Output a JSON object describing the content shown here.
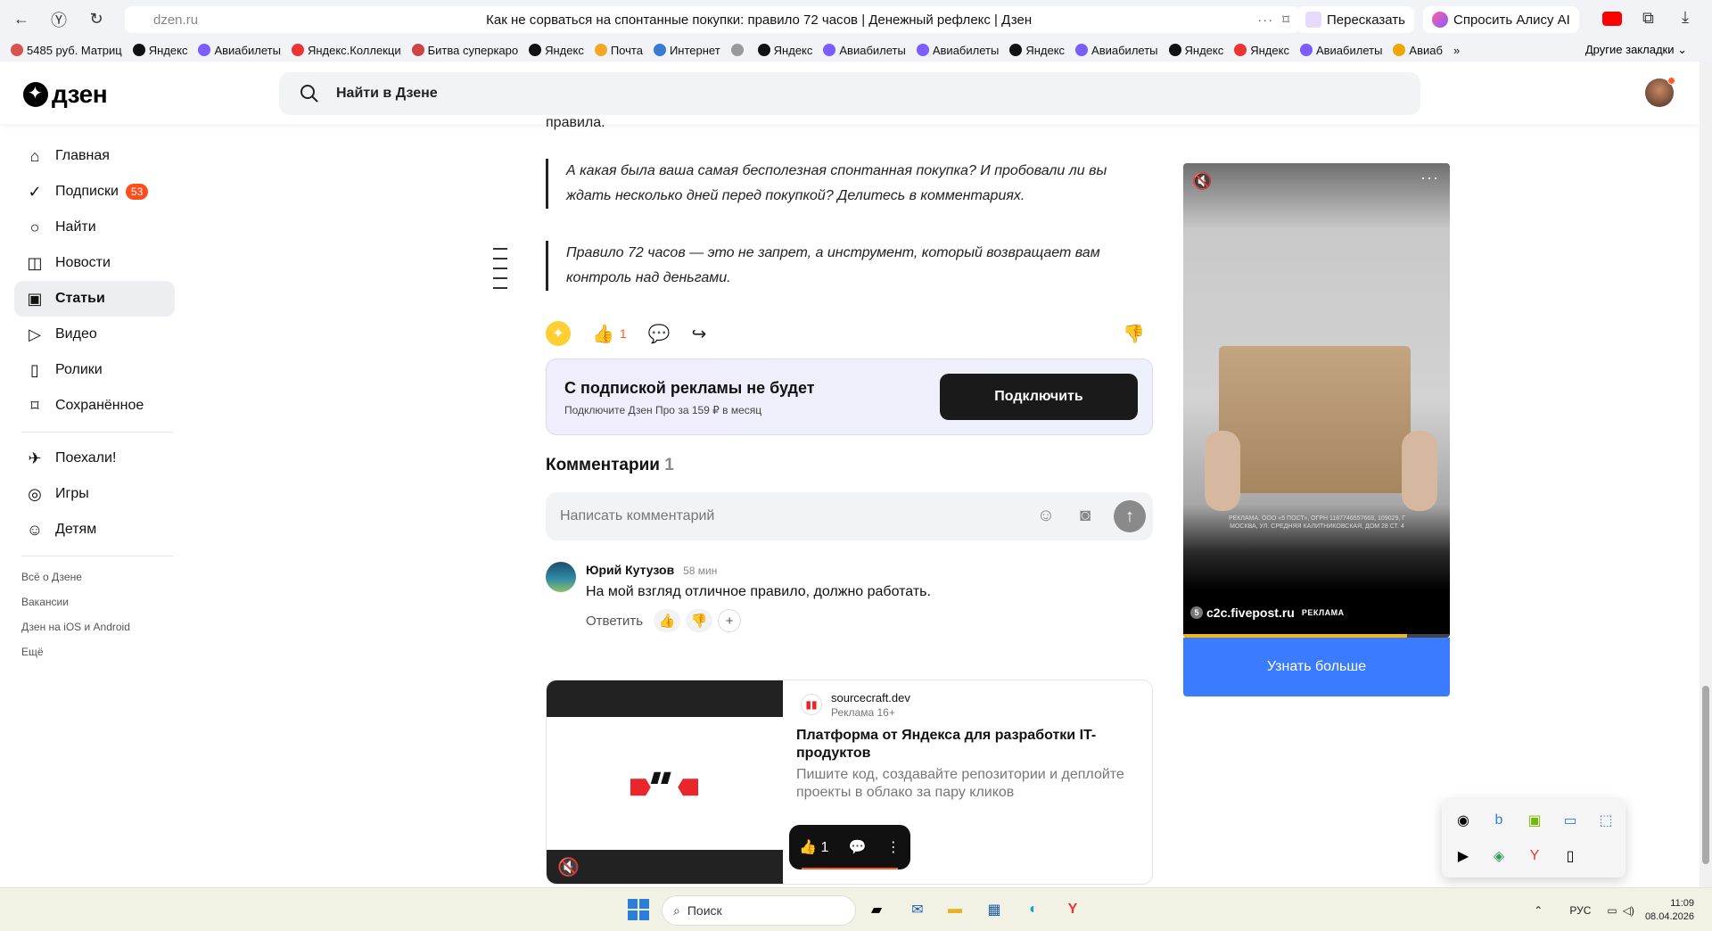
{
  "browser": {
    "domain": "dzen.ru",
    "tab_title": "Как не сорваться на спонтанные покупки: правило 72 часов | Денежный рефлекс | Дзен",
    "retell_label": "Пересказать",
    "alice_label": "Спросить Алису AI",
    "bookmarks": [
      {
        "label": "5485 руб. Матриц",
        "color": "#d9534f"
      },
      {
        "label": "Яндекс",
        "color": "#111"
      },
      {
        "label": "Авиабилеты",
        "color": "#7a5cff"
      },
      {
        "label": "Яндекс.Коллекци",
        "color": "#e33"
      },
      {
        "label": "Битва суперкаро",
        "color": "#c44"
      },
      {
        "label": "Яндекс",
        "color": "#111"
      },
      {
        "label": "Почта",
        "color": "#f5a623"
      },
      {
        "label": "Интернет",
        "color": "#3a7bd5"
      },
      {
        "label": "",
        "color": "#999"
      },
      {
        "label": "Яндекс",
        "color": "#111"
      },
      {
        "label": "Авиабилеты",
        "color": "#7a5cff"
      },
      {
        "label": "Авиабилеты",
        "color": "#7a5cff"
      },
      {
        "label": "Яндекс",
        "color": "#111"
      },
      {
        "label": "Авиабилеты",
        "color": "#7a5cff"
      },
      {
        "label": "Яндекс",
        "color": "#111"
      },
      {
        "label": "Яндекс",
        "color": "#e33"
      },
      {
        "label": "Авиабилеты",
        "color": "#7a5cff"
      },
      {
        "label": "Авиаб",
        "color": "#f0a500"
      }
    ],
    "other_bookmarks": "Другие закладки"
  },
  "header": {
    "logo": "дзен",
    "search_placeholder": "Найти в Дзене"
  },
  "sidebar": {
    "items": [
      {
        "label": "Главная",
        "icon": "home-icon",
        "glyph": "⌂"
      },
      {
        "label": "Подписки",
        "icon": "subscriptions-icon",
        "glyph": "✓",
        "badge": "53"
      },
      {
        "label": "Найти",
        "icon": "search-icon",
        "glyph": "○"
      },
      {
        "label": "Новости",
        "icon": "news-icon",
        "glyph": "◫"
      },
      {
        "label": "Статьи",
        "icon": "articles-icon",
        "glyph": "▣",
        "active": true
      },
      {
        "label": "Видео",
        "icon": "video-icon",
        "glyph": "▷"
      },
      {
        "label": "Ролики",
        "icon": "shorts-icon",
        "glyph": "▯"
      },
      {
        "label": "Сохранённое",
        "icon": "bookmark-icon",
        "glyph": "⌑"
      }
    ],
    "extra": [
      {
        "label": "Поехали!",
        "icon": "satellite-icon",
        "glyph": "✈"
      },
      {
        "label": "Игры",
        "icon": "gamepad-icon",
        "glyph": "◎"
      },
      {
        "label": "Детям",
        "icon": "kids-icon",
        "glyph": "☺"
      }
    ],
    "footer": [
      "Всё о Дзене",
      "Вакансии",
      "Дзен на iOS и Android",
      "Ещё"
    ]
  },
  "article": {
    "cut_text": "правила.",
    "quote1": "А какая была ваша самая бесполезная спонтанная покупка? И пробовали ли вы ждать несколько дней перед покупкой? Делитесь в комментариях.",
    "quote2": "Правило 72 часов — это не запрет, а инструмент, который возвращает вам контроль над деньгами.",
    "likes": "1"
  },
  "promo": {
    "title": "С подпиской рекламы не будет",
    "subtitle": "Подключите Дзен Про за 159 ₽ в месяц",
    "button": "Подключить"
  },
  "comments": {
    "heading": "Комментарии",
    "count": "1",
    "placeholder": "Написать комментарий",
    "items": [
      {
        "author": "Юрий Кутузов",
        "time": "58 мин",
        "text": "На мой взгляд отличное правило, должно работать.",
        "reply": "Ответить"
      }
    ]
  },
  "ad_card": {
    "source": "sourcecraft.dev",
    "label": "Реклама 16+",
    "title": "Платформа от Яндекса для разработки IT-продуктов",
    "description": "Пишите код, создавайте репозитории и деплойте проекты в облако за пару кликов"
  },
  "floatbar": {
    "likes": "1"
  },
  "video_ad": {
    "legal": "РЕКЛАМА. ООО «5 ПОСТ», ОГРН 1187746557668, 109029, Г МОСКВА, УЛ. СРЕДНЯЯ КАЛИТНИКОВСКАЯ, ДОМ 28 СТ. 4",
    "source": "c2c.fivepost.ru",
    "tag": "РЕКЛАМА",
    "progress": 0.84,
    "cta": "Узнать больше"
  },
  "taskbar": {
    "search": "Поиск",
    "lang": "РУС",
    "time": "11:09",
    "date": "08.04.2026"
  }
}
